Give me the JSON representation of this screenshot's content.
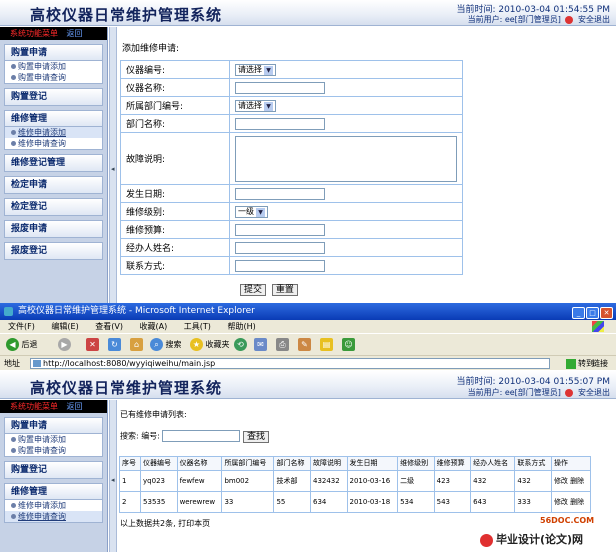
{
  "top": {
    "app_title": "高校仪器日常维护管理系统",
    "current_time": "当前时间: 2010-03-04 01:54:55 PM",
    "current_user": "当前用户: ee[部门管理员]",
    "logout": "安全退出"
  },
  "sidebar_top": {
    "menu_label": "系统功能菜单",
    "back_label": "返回",
    "groups": [
      {
        "title": "购置申请",
        "items": [
          "购置申请添加",
          "购置申请查询"
        ]
      },
      {
        "title": "购置登记"
      },
      {
        "title": "维修管理",
        "items": [
          "维修申请添加",
          "维修申请查询"
        ]
      },
      {
        "title": "维修登记管理"
      },
      {
        "title": "检定申请"
      },
      {
        "title": "检定登记"
      },
      {
        "title": "报废申请"
      },
      {
        "title": "报废登记"
      }
    ]
  },
  "form": {
    "title": "添加维修申请:",
    "please_select": "请选择",
    "level_default": "一级",
    "fields": {
      "instrument_code": "仪器编号:",
      "instrument_name": "仪器名称:",
      "dept_code": "所属部门编号:",
      "dept_name": "部门名称:",
      "fault_desc": "故障说明:",
      "date": "发生日期:",
      "level": "维修级别:",
      "budget": "维修预算:",
      "handler": "经办人姓名:",
      "contact": "联系方式:"
    },
    "submit": "提交",
    "reset": "重置"
  },
  "ie": {
    "title": "高校仪器日常维护管理系统 - Microsoft Internet Explorer",
    "menu": [
      "文件(F)",
      "编辑(E)",
      "查看(V)",
      "收藏(A)",
      "工具(T)",
      "帮助(H)"
    ],
    "back": "后退",
    "search": "搜索",
    "favorites": "收藏夹",
    "address": "http://localhost:8080/wyyiqiweihu/main.jsp",
    "go": "转到",
    "links": "链接"
  },
  "bottom": {
    "app_title": "高校仪器日常维护管理系统",
    "current_time": "当前时间: 2010-03-04 01:55:07 PM",
    "current_user": "当前用户: ee[部门管理员]",
    "logout": "安全退出"
  },
  "sidebar_bottom": {
    "menu_label": "系统功能菜单",
    "back_label": "返回",
    "groups": [
      {
        "title": "购置申请",
        "items": [
          "购置申请添加",
          "购置申请查询"
        ]
      },
      {
        "title": "购置登记"
      },
      {
        "title": "维修管理",
        "items": [
          "维修申请添加",
          "维修申请查询"
        ]
      }
    ]
  },
  "list": {
    "title": "已有维修申请列表:",
    "search_label": "搜索: 编号:",
    "search_button": "查找",
    "headers": [
      "序号",
      "仪器编号",
      "仪器名称",
      "所属部门编号",
      "部门名称",
      "故障说明",
      "发生日期",
      "维修级别",
      "维修预算",
      "经办人姓名",
      "联系方式",
      "操作"
    ],
    "rows": [
      [
        "1",
        "yq023",
        "fewfew",
        "bm002",
        "技术部",
        "432432",
        "2010-03-16",
        "二级",
        "423",
        "432",
        "432",
        "修改 删除"
      ],
      [
        "2",
        "53535",
        "werewrew",
        "33",
        "55",
        "634",
        "2010-03-18",
        "534",
        "543",
        "643",
        "333",
        "修改 删除"
      ]
    ],
    "footer": "以上数据共2条, 打印本页"
  },
  "watermark": {
    "site": "56DOC.COM",
    "brand": "毕业设计(论文)网"
  }
}
